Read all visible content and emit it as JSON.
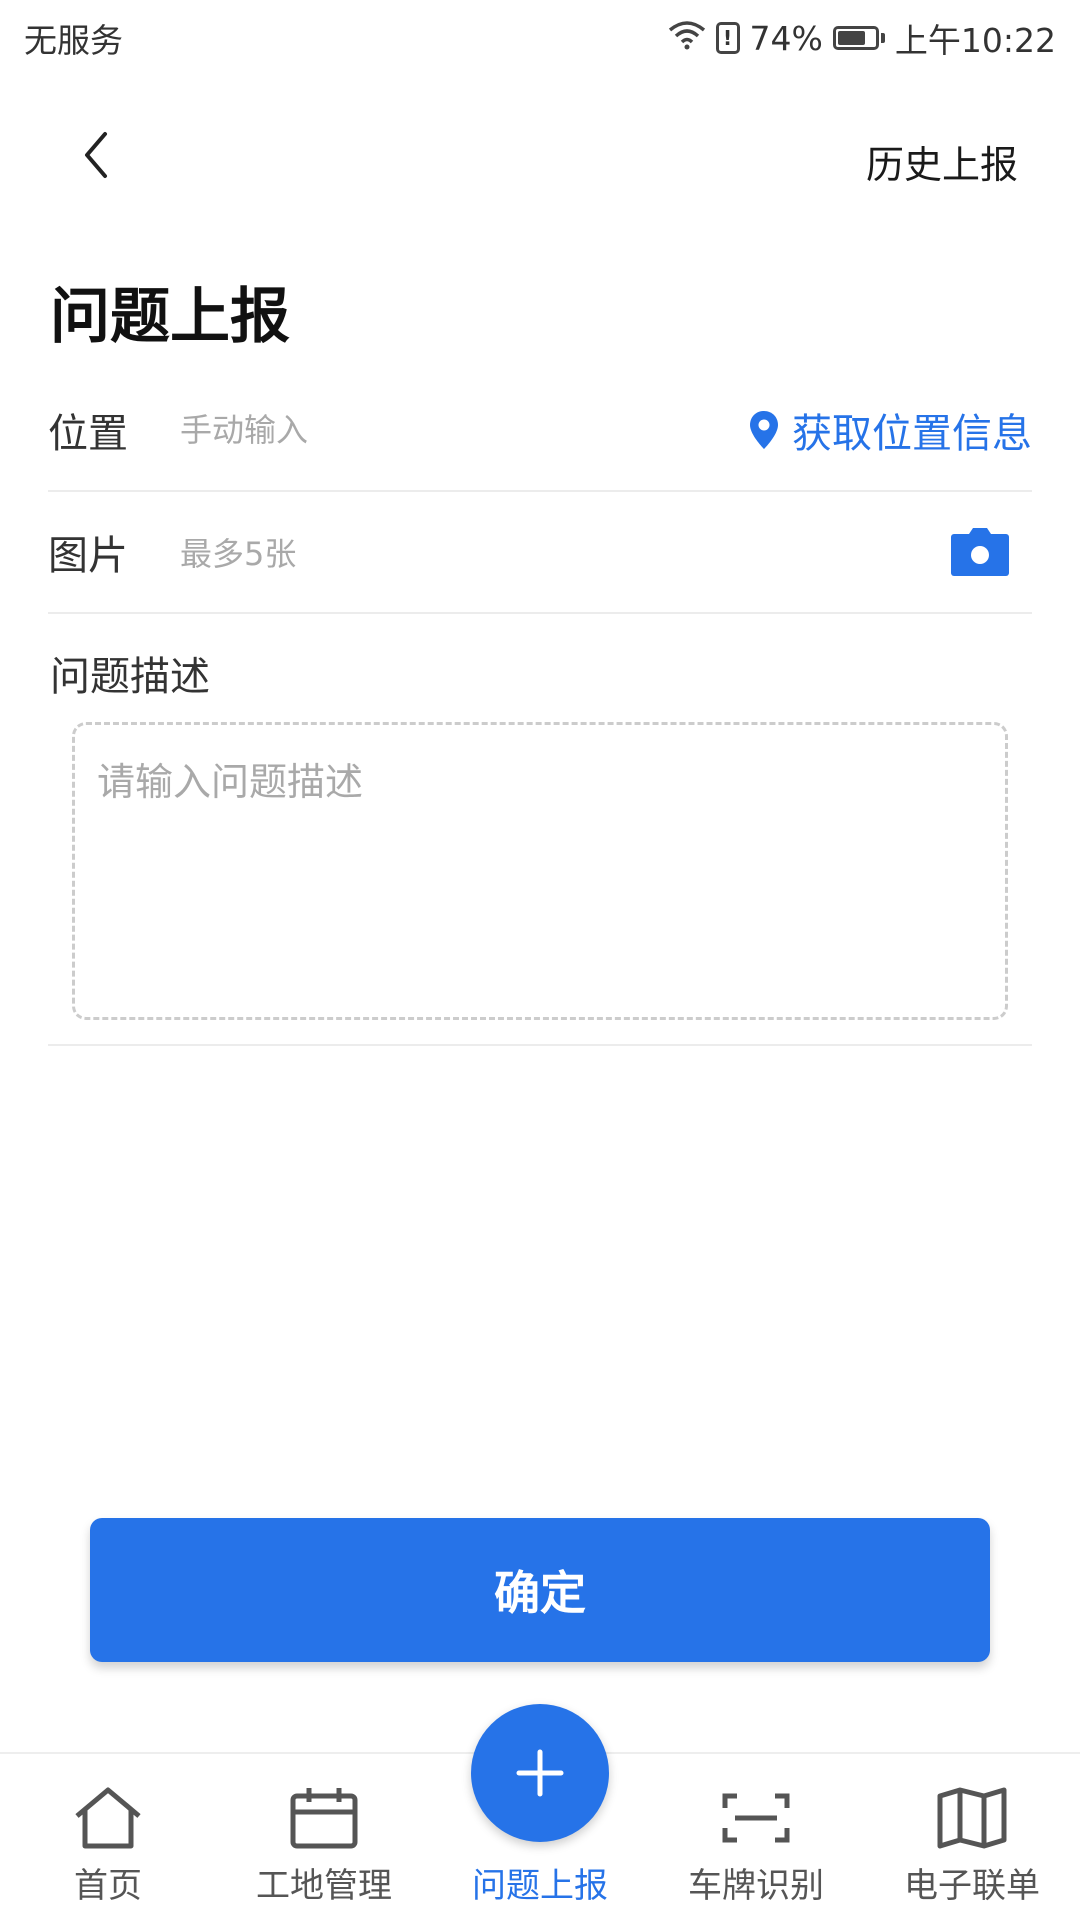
{
  "status_bar": {
    "carrier": "无服务",
    "battery_percent": "74%",
    "battery_level": 0.74,
    "alert_glyph": "!",
    "time": "上午10:22"
  },
  "nav": {
    "back_icon": "chevron-left-icon",
    "history_label": "历史上报"
  },
  "page_title": "问题上报",
  "form": {
    "location": {
      "label": "位置",
      "placeholder": "手动输入",
      "action_label": "获取位置信息",
      "action_icon": "location-pin-icon"
    },
    "images": {
      "label": "图片",
      "hint": "最多5张",
      "action_icon": "camera-icon"
    },
    "description": {
      "label": "问题描述",
      "placeholder": "请输入问题描述"
    }
  },
  "confirm_label": "确定",
  "tabs": [
    {
      "label": "首页",
      "icon": "home-icon",
      "active": false
    },
    {
      "label": "工地管理",
      "icon": "calendar-icon",
      "active": false
    },
    {
      "label": "问题上报",
      "icon": "plus-icon",
      "active": true
    },
    {
      "label": "车牌识别",
      "icon": "scan-icon",
      "active": false
    },
    {
      "label": "电子联单",
      "icon": "map-icon",
      "active": false
    }
  ],
  "colors": {
    "accent": "#2673e8",
    "text_primary": "#222222",
    "placeholder": "#a9a9a9",
    "divider": "#ececec"
  }
}
